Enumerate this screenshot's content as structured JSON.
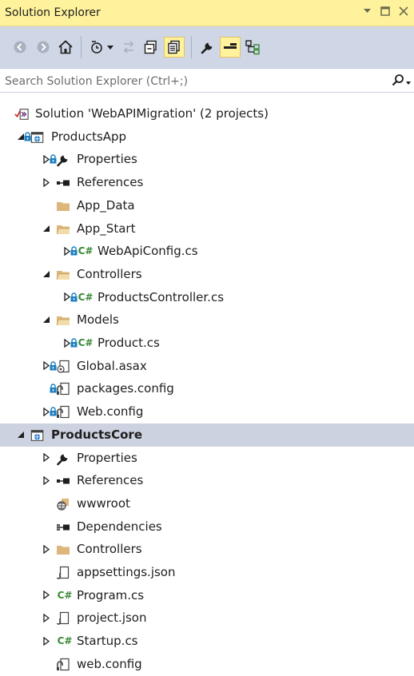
{
  "window": {
    "title": "Solution Explorer"
  },
  "toolbar": {
    "buttons": [
      {
        "icon": "back-icon"
      },
      {
        "icon": "forward-icon"
      },
      {
        "icon": "home-icon"
      },
      {
        "icon": "pending-changes-filter-icon"
      },
      {
        "icon": "sync-with-active-document-icon"
      },
      {
        "icon": "collapse-all-icon"
      },
      {
        "icon": "show-all-files-icon",
        "active": true
      },
      {
        "icon": "properties-icon"
      },
      {
        "icon": "preview-selected-items-icon",
        "active": true
      },
      {
        "icon": "class-view-icon"
      }
    ]
  },
  "search": {
    "placeholder": "Search Solution Explorer (Ctrl+;)"
  },
  "tree": [
    {
      "label": "Solution 'WebAPIMigration' (2 projects)",
      "icon": "solution-icon",
      "level": 0
    },
    {
      "label": "ProductsApp",
      "icon": "web-project-icon",
      "level": 0,
      "expander": "expanded",
      "locked": true
    },
    {
      "label": "Properties",
      "icon": "wrench-icon",
      "level": 1,
      "expander": "collapsed",
      "locked": true
    },
    {
      "label": "References",
      "icon": "references-icon",
      "level": 1,
      "expander": "collapsed"
    },
    {
      "label": "App_Data",
      "icon": "folder-icon",
      "level": 1
    },
    {
      "label": "App_Start",
      "icon": "folder-open-icon",
      "level": 1,
      "expander": "expanded"
    },
    {
      "label": "WebApiConfig.cs",
      "icon": "csharp-file-icon",
      "level": 2,
      "expander": "collapsed",
      "locked": true
    },
    {
      "label": "Controllers",
      "icon": "folder-open-icon",
      "level": 1,
      "expander": "expanded"
    },
    {
      "label": "ProductsController.cs",
      "icon": "csharp-file-icon",
      "level": 2,
      "expander": "collapsed",
      "locked": true
    },
    {
      "label": "Models",
      "icon": "folder-open-icon",
      "level": 1,
      "expander": "expanded"
    },
    {
      "label": "Product.cs",
      "icon": "csharp-file-icon",
      "level": 2,
      "expander": "collapsed",
      "locked": true
    },
    {
      "label": "Global.asax",
      "icon": "global-asax-icon",
      "level": 1,
      "expander": "collapsed",
      "locked": true
    },
    {
      "label": "packages.config",
      "icon": "config-file-icon",
      "level": 1,
      "locked": true
    },
    {
      "label": "Web.config",
      "icon": "config-file-icon",
      "level": 1,
      "expander": "collapsed",
      "locked": true
    },
    {
      "label": "ProductsCore",
      "icon": "web-project-icon",
      "level": 0,
      "expander": "expanded",
      "selected": true
    },
    {
      "label": "Properties",
      "icon": "wrench-icon",
      "level": 1,
      "expander": "collapsed"
    },
    {
      "label": "References",
      "icon": "references-icon",
      "level": 1,
      "expander": "collapsed"
    },
    {
      "label": "wwwroot",
      "icon": "globe-icon",
      "level": 1
    },
    {
      "label": "Dependencies",
      "icon": "dependencies-icon",
      "level": 1
    },
    {
      "label": "Controllers",
      "icon": "folder-icon",
      "level": 1,
      "expander": "collapsed"
    },
    {
      "label": "appsettings.json",
      "icon": "json-file-icon",
      "level": 1
    },
    {
      "label": "Program.cs",
      "icon": "csharp-file-icon",
      "level": 1,
      "expander": "collapsed"
    },
    {
      "label": "project.json",
      "icon": "json-file-icon",
      "level": 1,
      "expander": "collapsed"
    },
    {
      "label": "Startup.cs",
      "icon": "csharp-file-icon",
      "level": 1,
      "expander": "collapsed"
    },
    {
      "label": "web.config",
      "icon": "config-file-icon",
      "level": 1
    }
  ]
}
